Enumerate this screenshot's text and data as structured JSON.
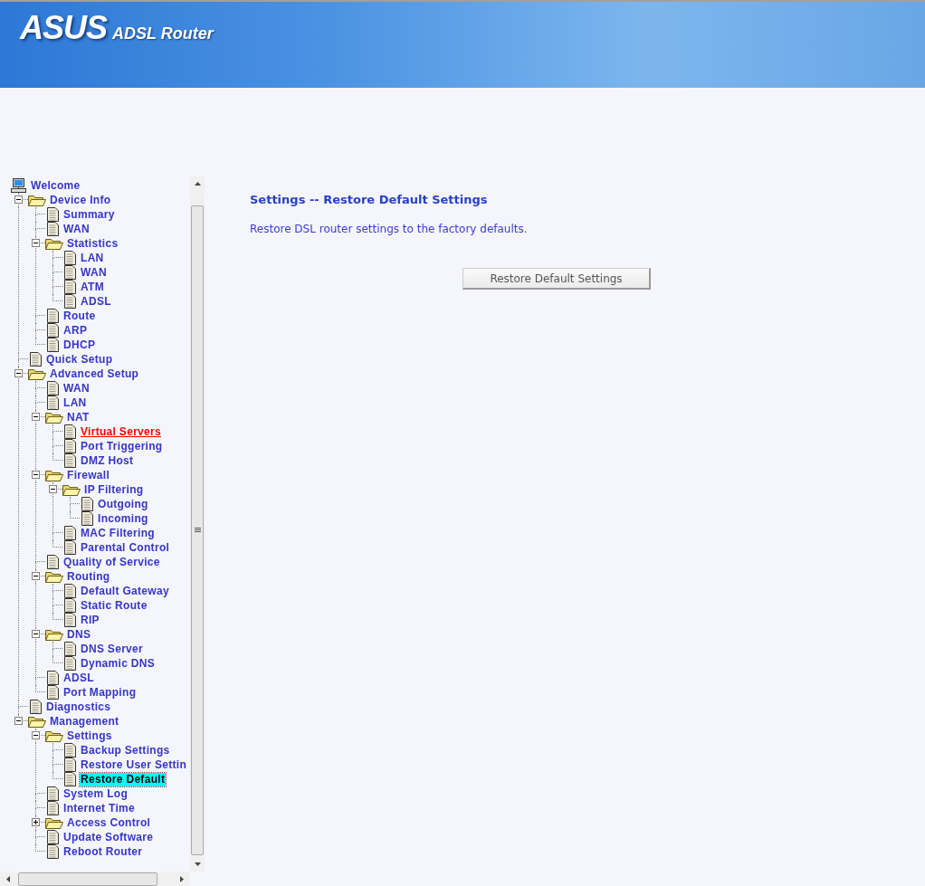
{
  "header": {
    "logo": "ASUS",
    "product": "ADSL Router"
  },
  "tree": [
    {
      "label": "Welcome",
      "kind": "computer",
      "selected": false,
      "hovered": false,
      "children": [
        {
          "label": "Device Info",
          "kind": "folder",
          "expanded": true,
          "selected": false,
          "hovered": false,
          "children": [
            {
              "label": "Summary",
              "kind": "page",
              "selected": false,
              "hovered": false
            },
            {
              "label": "WAN",
              "kind": "page",
              "selected": false,
              "hovered": false
            },
            {
              "label": "Statistics",
              "kind": "folder",
              "expanded": true,
              "selected": false,
              "hovered": false,
              "children": [
                {
                  "label": "LAN",
                  "kind": "page",
                  "selected": false,
                  "hovered": false
                },
                {
                  "label": "WAN",
                  "kind": "page",
                  "selected": false,
                  "hovered": false
                },
                {
                  "label": "ATM",
                  "kind": "page",
                  "selected": false,
                  "hovered": false
                },
                {
                  "label": "ADSL",
                  "kind": "page",
                  "selected": false,
                  "hovered": false
                }
              ]
            },
            {
              "label": "Route",
              "kind": "page",
              "selected": false,
              "hovered": false
            },
            {
              "label": "ARP",
              "kind": "page",
              "selected": false,
              "hovered": false
            },
            {
              "label": "DHCP",
              "kind": "page",
              "selected": false,
              "hovered": false
            }
          ]
        },
        {
          "label": "Quick Setup",
          "kind": "page",
          "selected": false,
          "hovered": false
        },
        {
          "label": "Advanced Setup",
          "kind": "folder",
          "expanded": true,
          "selected": false,
          "hovered": false,
          "children": [
            {
              "label": "WAN",
              "kind": "page",
              "selected": false,
              "hovered": false
            },
            {
              "label": "LAN",
              "kind": "page",
              "selected": false,
              "hovered": false
            },
            {
              "label": "NAT",
              "kind": "folder",
              "expanded": true,
              "selected": false,
              "hovered": false,
              "children": [
                {
                  "label": "Virtual Servers",
                  "kind": "page",
                  "selected": false,
                  "hovered": true
                },
                {
                  "label": "Port Triggering",
                  "kind": "page",
                  "selected": false,
                  "hovered": false
                },
                {
                  "label": "DMZ Host",
                  "kind": "page",
                  "selected": false,
                  "hovered": false
                }
              ]
            },
            {
              "label": "Firewall",
              "kind": "folder",
              "expanded": true,
              "selected": false,
              "hovered": false,
              "children": [
                {
                  "label": "IP Filtering",
                  "kind": "folder",
                  "expanded": true,
                  "selected": false,
                  "hovered": false,
                  "children": [
                    {
                      "label": "Outgoing",
                      "kind": "page",
                      "selected": false,
                      "hovered": false
                    },
                    {
                      "label": "Incoming",
                      "kind": "page",
                      "selected": false,
                      "hovered": false
                    }
                  ]
                },
                {
                  "label": "MAC Filtering",
                  "kind": "page",
                  "selected": false,
                  "hovered": false
                },
                {
                  "label": "Parental Control",
                  "kind": "page",
                  "selected": false,
                  "hovered": false
                }
              ]
            },
            {
              "label": "Quality of Service",
              "kind": "page",
              "selected": false,
              "hovered": false
            },
            {
              "label": "Routing",
              "kind": "folder",
              "expanded": true,
              "selected": false,
              "hovered": false,
              "children": [
                {
                  "label": "Default Gateway",
                  "kind": "page",
                  "selected": false,
                  "hovered": false
                },
                {
                  "label": "Static Route",
                  "kind": "page",
                  "selected": false,
                  "hovered": false
                },
                {
                  "label": "RIP",
                  "kind": "page",
                  "selected": false,
                  "hovered": false
                }
              ]
            },
            {
              "label": "DNS",
              "kind": "folder",
              "expanded": true,
              "selected": false,
              "hovered": false,
              "children": [
                {
                  "label": "DNS Server",
                  "kind": "page",
                  "selected": false,
                  "hovered": false
                },
                {
                  "label": "Dynamic DNS",
                  "kind": "page",
                  "selected": false,
                  "hovered": false
                }
              ]
            },
            {
              "label": "ADSL",
              "kind": "page",
              "selected": false,
              "hovered": false
            },
            {
              "label": "Port Mapping",
              "kind": "page",
              "selected": false,
              "hovered": false
            }
          ]
        },
        {
          "label": "Diagnostics",
          "kind": "page",
          "selected": false,
          "hovered": false
        },
        {
          "label": "Management",
          "kind": "folder",
          "expanded": true,
          "selected": false,
          "hovered": false,
          "children": [
            {
              "label": "Settings",
              "kind": "folder",
              "expanded": true,
              "selected": false,
              "hovered": false,
              "children": [
                {
                  "label": "Backup Settings",
                  "kind": "page",
                  "selected": false,
                  "hovered": false
                },
                {
                  "label": "Restore User Settin",
                  "kind": "page",
                  "selected": false,
                  "hovered": false
                },
                {
                  "label": "Restore Default",
                  "kind": "page",
                  "selected": true,
                  "hovered": false
                }
              ]
            },
            {
              "label": "System Log",
              "kind": "page",
              "selected": false,
              "hovered": false
            },
            {
              "label": "Internet Time",
              "kind": "page",
              "selected": false,
              "hovered": false
            },
            {
              "label": "Access Control",
              "kind": "folder",
              "expanded": false,
              "selected": false,
              "hovered": false
            },
            {
              "label": "Update Software",
              "kind": "page",
              "selected": false,
              "hovered": false
            },
            {
              "label": "Reboot Router",
              "kind": "page",
              "selected": false,
              "hovered": false
            }
          ]
        }
      ]
    }
  ],
  "content": {
    "title": "Settings -- Restore Default Settings",
    "description": "Restore DSL router settings to the factory defaults.",
    "button": "Restore Default Settings"
  }
}
